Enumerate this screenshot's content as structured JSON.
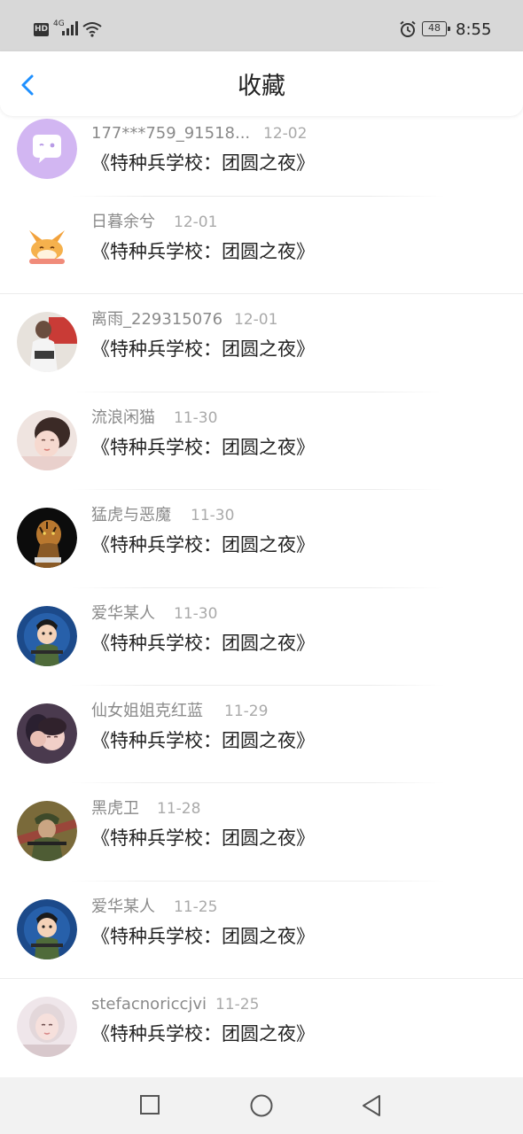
{
  "status_bar": {
    "hd_badge": "HD",
    "network": "4G",
    "battery": "48",
    "time": "8:55",
    "icons": [
      "signal-icon",
      "wifi-icon",
      "alarm-icon",
      "battery-icon"
    ]
  },
  "header": {
    "back_icon": "chevron-left-icon",
    "title": "收藏",
    "accent_color": "#1e90ff"
  },
  "items": [
    {
      "user": "177***759_91518...",
      "date": "12-02",
      "title": "《特种兵学校：团圆之夜》",
      "avatar": "chat-bubble-avatar"
    },
    {
      "user": "日暮余兮",
      "date": "12-01",
      "title": "《特种兵学校：团圆之夜》",
      "avatar": "fox-avatar"
    },
    {
      "user": "离雨_229315076",
      "date": "12-01",
      "title": "《特种兵学校：团圆之夜》",
      "avatar": "photo-avatar"
    },
    {
      "user": "流浪闲猫",
      "date": "11-30",
      "title": "《特种兵学校：团圆之夜》",
      "avatar": "photo-avatar"
    },
    {
      "user": "猛虎与恶魔",
      "date": "11-30",
      "title": "《特种兵学校：团圆之夜》",
      "avatar": "tiger-avatar"
    },
    {
      "user": "爱华某人",
      "date": "11-30",
      "title": "《特种兵学校：团圆之夜》",
      "avatar": "cartoon-soldier-avatar"
    },
    {
      "user": "仙女姐姐克红蓝",
      "date": "11-29",
      "title": "《特种兵学校：团圆之夜》",
      "avatar": "photo-avatar"
    },
    {
      "user": "黑虎卫",
      "date": "11-28",
      "title": "《特种兵学校：团圆之夜》",
      "avatar": "soldier-avatar"
    },
    {
      "user": "爱华某人",
      "date": "11-25",
      "title": "《特种兵学校：团圆之夜》",
      "avatar": "cartoon-soldier-avatar"
    },
    {
      "user": "stefacnoriccjvi",
      "date": "11-25",
      "title": "《特种兵学校：团圆之夜》",
      "avatar": "photo-avatar"
    }
  ],
  "bottom_nav": {
    "icons": [
      "recents-square-icon",
      "home-circle-icon",
      "back-triangle-icon"
    ]
  }
}
